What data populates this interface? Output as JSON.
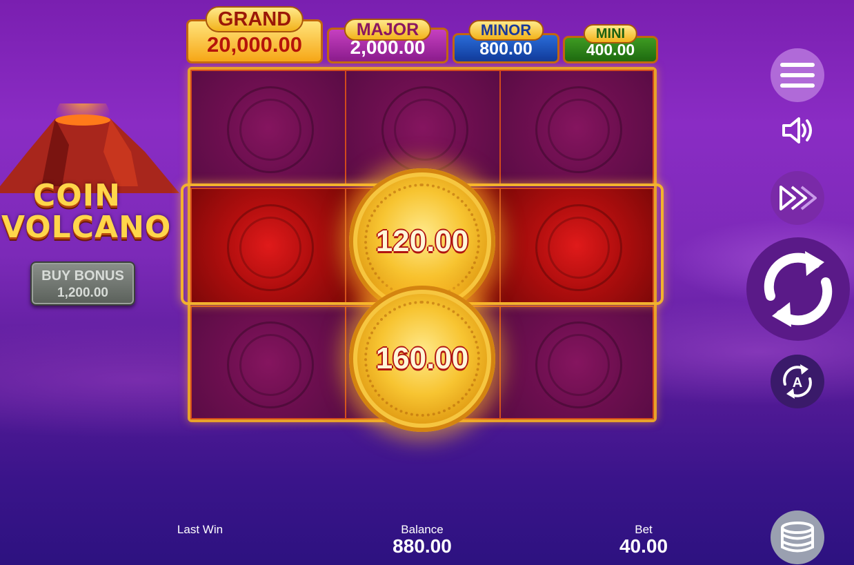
{
  "game": {
    "logo_line1": "COIN",
    "logo_line2": "VOLCANO"
  },
  "buy_bonus": {
    "label": "BUY BONUS",
    "price": "1,200.00"
  },
  "jackpots": [
    {
      "name": "GRAND",
      "value": "20,000.00",
      "color": "#f6a717"
    },
    {
      "name": "MAJOR",
      "value": "2,000.00",
      "color": "#8a1b8c"
    },
    {
      "name": "MINOR",
      "value": "800.00",
      "color": "#103a9a"
    },
    {
      "name": "MINI",
      "value": "400.00",
      "color": "#1d6a10"
    }
  ],
  "reels": {
    "rows": 3,
    "cols": 3,
    "active_row": 2,
    "coins": [
      {
        "row": 2,
        "col": 2,
        "value": "120.00"
      },
      {
        "row": 3,
        "col": 2,
        "value": "160.00"
      }
    ]
  },
  "controls": {
    "menu_icon": "hamburger-menu-icon",
    "sound_icon": "speaker-icon",
    "turbo_icon": "fast-forward-icon",
    "spin_icon": "refresh-arrows-icon",
    "autoplay_icon": "autoplay-icon",
    "autoplay_letter": "A",
    "bet_icon": "coin-stack-icon"
  },
  "bottom_bar": {
    "last_win_label": "Last Win",
    "last_win_value": "",
    "balance_label": "Balance",
    "balance_value": "880.00",
    "bet_label": "Bet",
    "bet_value": "40.00"
  },
  "colors": {
    "background": "#7a1fb0",
    "frame_gold": "#e8a22a",
    "active_cell": "#b10e0e"
  }
}
